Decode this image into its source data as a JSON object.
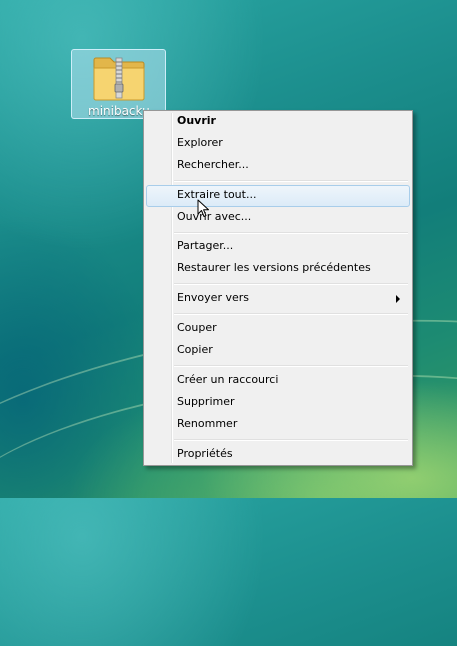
{
  "desktop": {
    "icon": {
      "label": "minibacku",
      "icon_name": "zip-folder-icon"
    }
  },
  "context_menu": {
    "items": [
      {
        "label": "Ouvrir"
      },
      {
        "label": "Explorer"
      },
      {
        "label": "Rechercher..."
      },
      {
        "label": "Extraire tout..."
      },
      {
        "label": "Ouvrir avec..."
      },
      {
        "label": "Partager..."
      },
      {
        "label": "Restaurer les versions précédentes"
      },
      {
        "label": "Envoyer vers"
      },
      {
        "label": "Couper"
      },
      {
        "label": "Copier"
      },
      {
        "label": "Créer un raccourci"
      },
      {
        "label": "Supprimer"
      },
      {
        "label": "Renommer"
      },
      {
        "label": "Propriétés"
      }
    ],
    "default_item": "Ouvrir",
    "hovered_item": "Extraire tout...",
    "submenu_item": "Envoyer vers"
  },
  "colors": {
    "menu_background": "#f0f0f0",
    "hover_border": "#a8cdea",
    "hover_fill": "#dcebf8",
    "selection_fill": "#b4e1f0"
  }
}
